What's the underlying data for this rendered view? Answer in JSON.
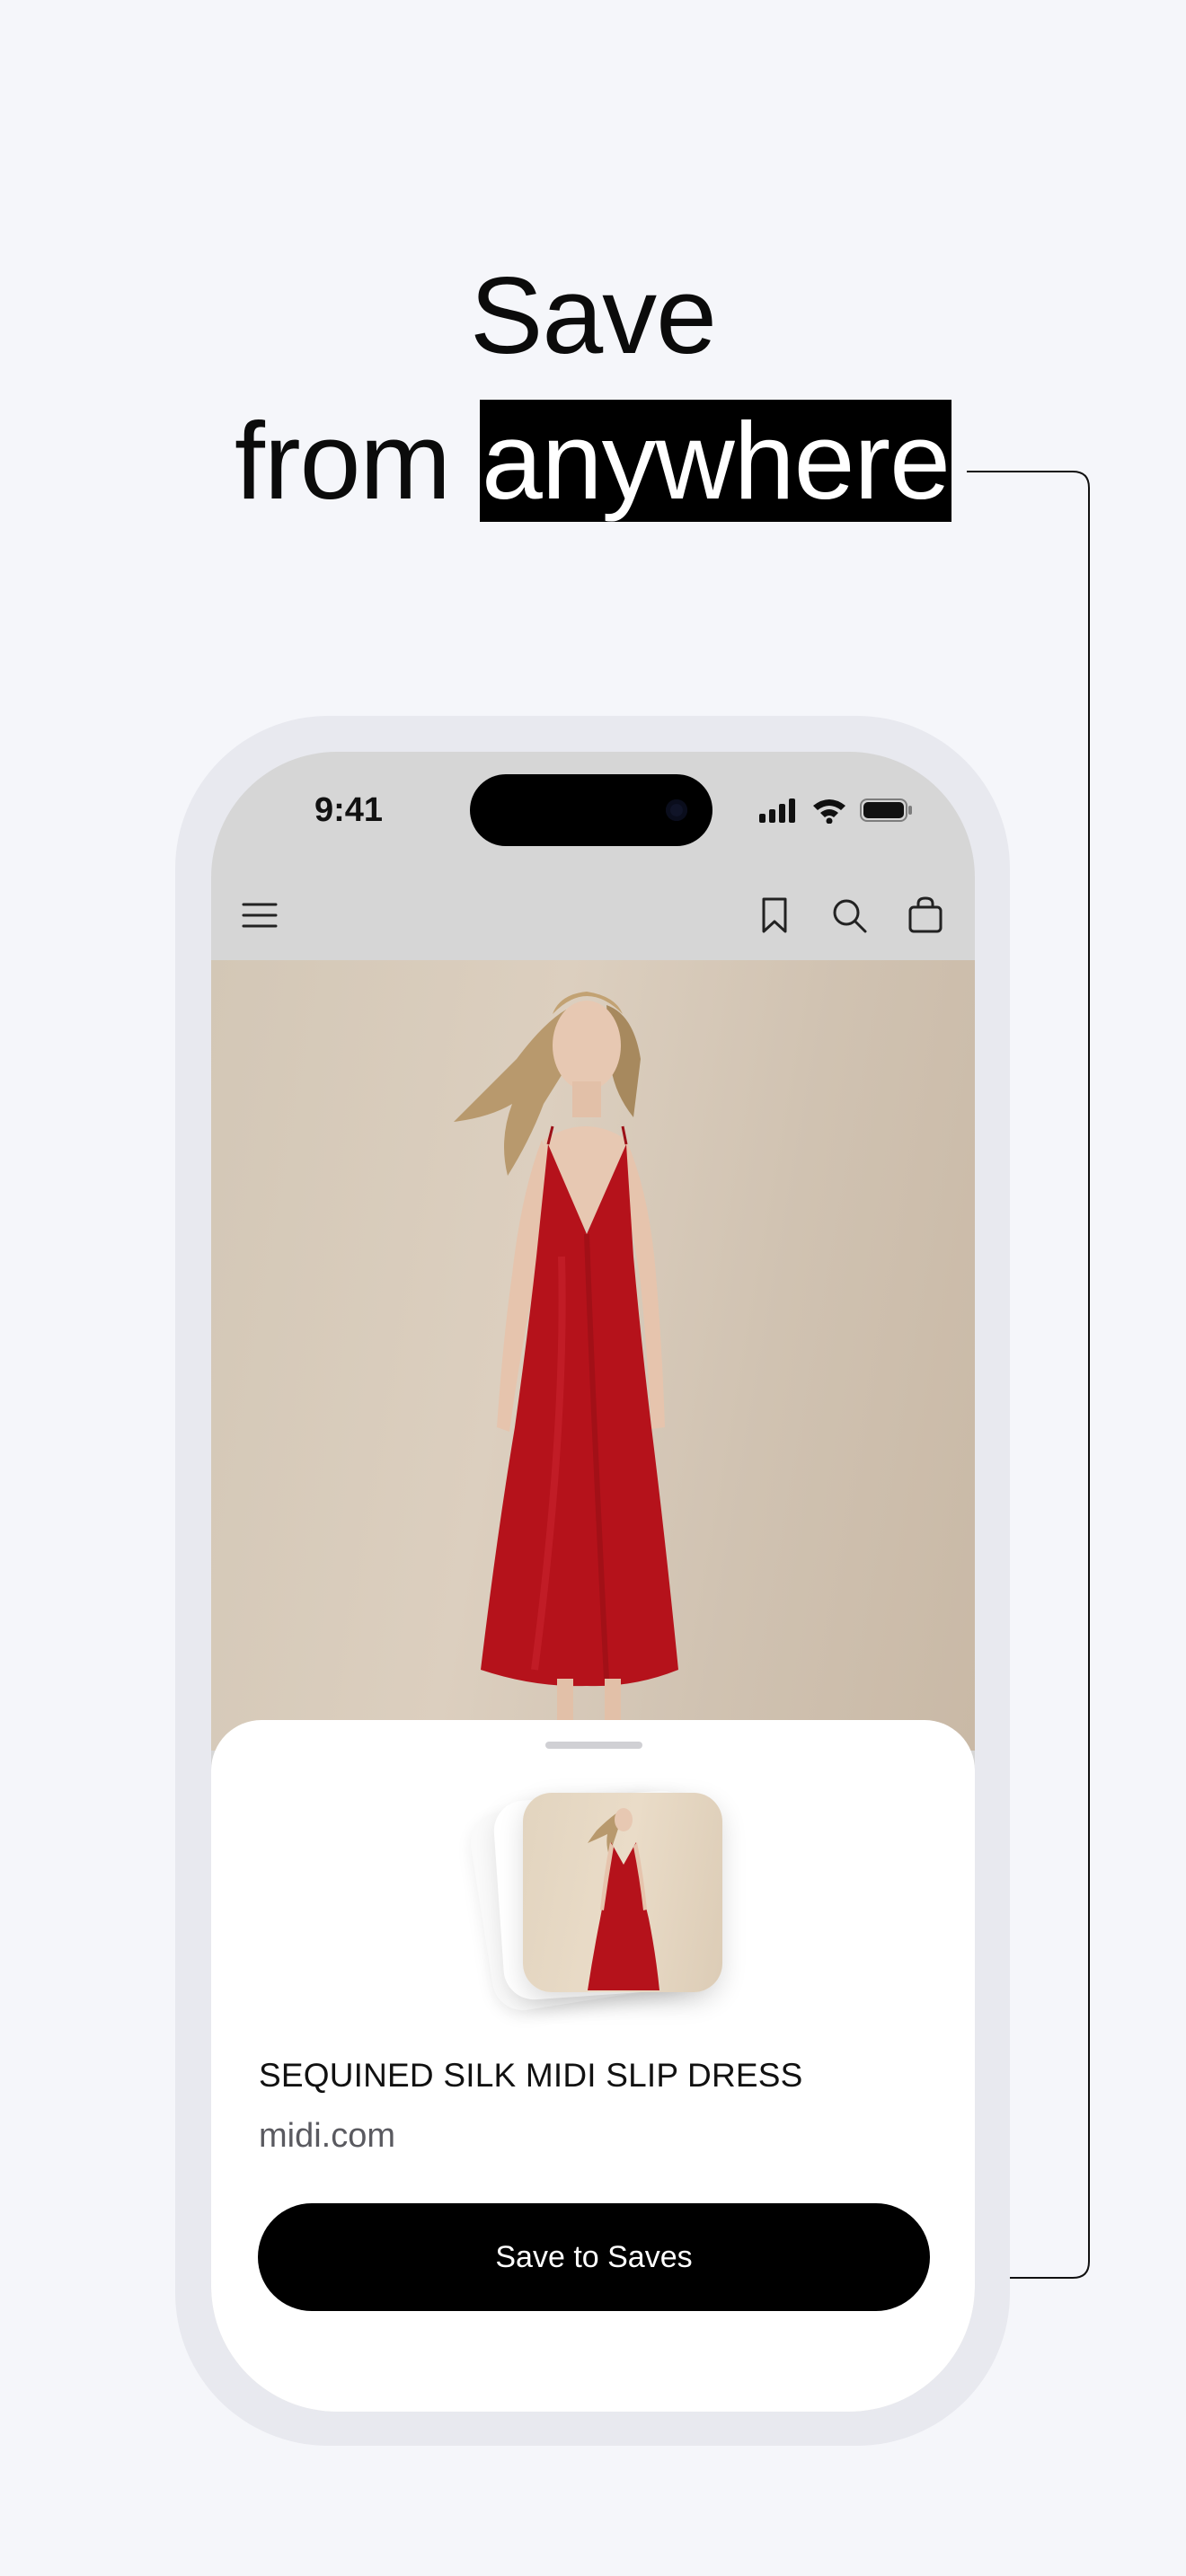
{
  "headline": {
    "line1": "Save",
    "line2_plain": "from",
    "line2_highlight": "anywhere"
  },
  "status_bar": {
    "time": "9:41",
    "icons": [
      "signal-icon",
      "wifi-icon",
      "battery-icon"
    ]
  },
  "navbar": {
    "icons": [
      "menu-icon",
      "bookmark-icon",
      "search-icon",
      "shopping-bag-icon"
    ]
  },
  "product": {
    "title": "SEQUINED SILK MIDI SLIP DRESS",
    "domain": "midi.com"
  },
  "sheet": {
    "cta_label": "Save to Saves"
  },
  "colors": {
    "background": "#f5f6fa",
    "phone_frame": "#e8e9ef",
    "highlight": "#000000",
    "cta": "#000000",
    "dress": "#b5121b"
  }
}
